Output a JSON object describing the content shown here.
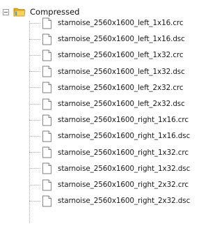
{
  "tree": {
    "root": {
      "label": "Compressed",
      "icon": "folder-icon",
      "expander_icon": "collapse-minus-icon"
    },
    "children": [
      {
        "label": "starnoise_2560x1600_left_1x16.crc",
        "icon": "file-icon"
      },
      {
        "label": "starnoise_2560x1600_left_1x16.dsc",
        "icon": "file-icon"
      },
      {
        "label": "starnoise_2560x1600_left_1x32.crc",
        "icon": "file-icon"
      },
      {
        "label": "starnoise_2560x1600_left_1x32.dsc",
        "icon": "file-icon"
      },
      {
        "label": "starnoise_2560x1600_left_2x32.crc",
        "icon": "file-icon"
      },
      {
        "label": "starnoise_2560x1600_left_2x32.dsc",
        "icon": "file-icon"
      },
      {
        "label": "starnoise_2560x1600_right_1x16.crc",
        "icon": "file-icon"
      },
      {
        "label": "starnoise_2560x1600_right_1x16.dsc",
        "icon": "file-icon"
      },
      {
        "label": "starnoise_2560x1600_right_1x32.crc",
        "icon": "file-icon"
      },
      {
        "label": "starnoise_2560x1600_right_1x32.dsc",
        "icon": "file-icon"
      },
      {
        "label": "starnoise_2560x1600_right_2x32.crc",
        "icon": "file-icon"
      },
      {
        "label": "starnoise_2560x1600_right_2x32.dsc",
        "icon": "file-icon"
      }
    ]
  },
  "colors": {
    "folder_yellow": "#f2c23a",
    "connector_gray": "#a8a8a8",
    "text": "#1a1a1a"
  }
}
